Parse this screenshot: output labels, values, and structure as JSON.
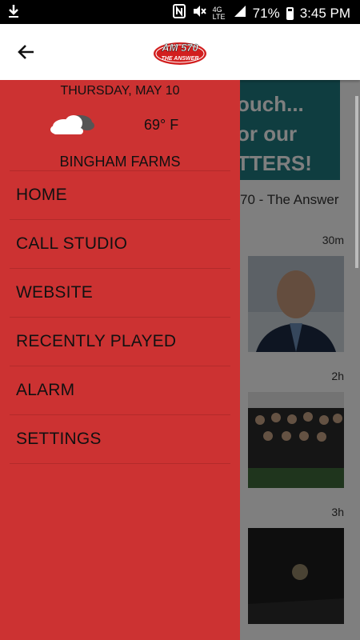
{
  "status_bar": {
    "battery": "71%",
    "time": "3:45 PM",
    "network": "4G LTE"
  },
  "app_bar": {
    "logo_top": "AM 570",
    "logo_bottom": "THE ANSWER"
  },
  "background": {
    "banner_lines": [
      "ouch...",
      "or our",
      "TTERS!"
    ],
    "station_label": "70 - The Answer",
    "items": [
      {
        "age": "30m"
      },
      {
        "age": "2h"
      },
      {
        "age": "3h"
      }
    ]
  },
  "drawer": {
    "date": "THURSDAY, MAY 10",
    "weather_icon": "partly-cloudy-icon",
    "temperature": "69° F",
    "location": "BINGHAM FARMS",
    "menu": [
      {
        "label": "HOME"
      },
      {
        "label": "CALL STUDIO"
      },
      {
        "label": "WEBSITE"
      },
      {
        "label": "RECENTLY PLAYED"
      },
      {
        "label": "ALARM"
      },
      {
        "label": "SETTINGS"
      }
    ],
    "color": "#cc3232"
  }
}
